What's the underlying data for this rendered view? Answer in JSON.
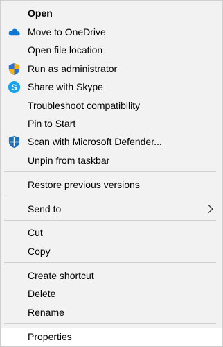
{
  "menu": {
    "open": "Open",
    "move_to_onedrive": "Move to OneDrive",
    "open_file_location": "Open file location",
    "run_as_admin": "Run as administrator",
    "share_skype": "Share with Skype",
    "troubleshoot": "Troubleshoot compatibility",
    "pin_to_start": "Pin to Start",
    "scan_defender": "Scan with Microsoft Defender...",
    "unpin_taskbar": "Unpin from taskbar",
    "restore_versions": "Restore previous versions",
    "send_to": "Send to",
    "cut": "Cut",
    "copy": "Copy",
    "create_shortcut": "Create shortcut",
    "delete": "Delete",
    "rename": "Rename",
    "properties": "Properties"
  },
  "icons": {
    "onedrive": "onedrive-cloud-icon",
    "admin": "uac-shield-icon",
    "skype": "skype-icon",
    "defender": "defender-shield-icon",
    "submenu": "chevron-right-icon"
  },
  "colors": {
    "menu_bg": "#f2f2f2",
    "hover_bg": "#ffffff",
    "separator": "#cfcfcf",
    "onedrive_blue": "#0f78d4",
    "skype_blue": "#1da1e8",
    "defender_blue": "#1e6fb8"
  },
  "state": {
    "highlighted_item": "properties"
  }
}
